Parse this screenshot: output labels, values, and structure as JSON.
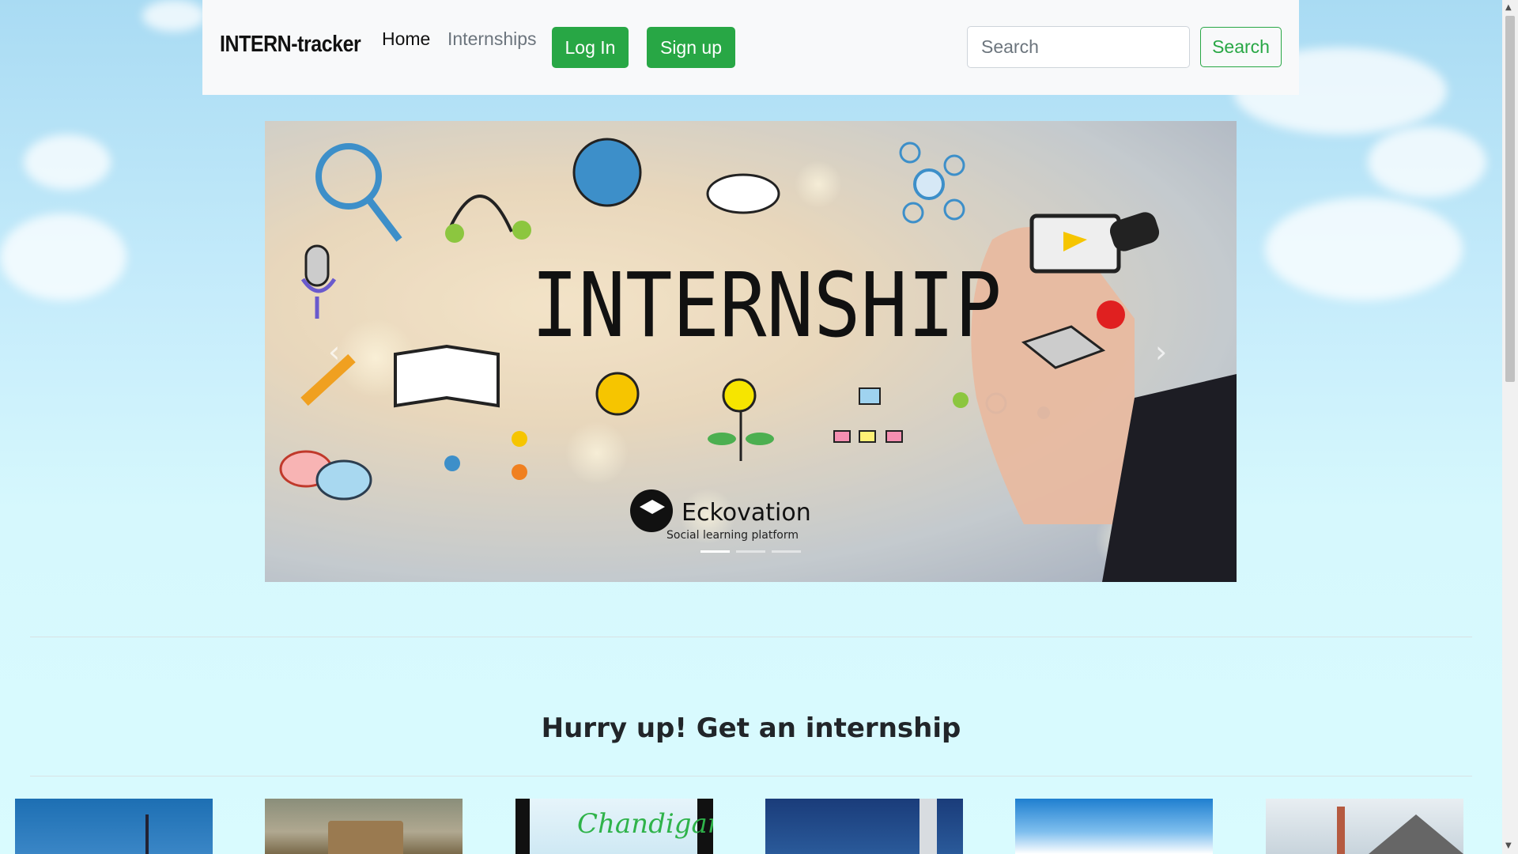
{
  "navbar": {
    "brand": "INTERN-tracker",
    "home_label": "Home",
    "internships_label": "Internships",
    "login_label": "Log In",
    "signup_label": "Sign up",
    "search_placeholder": "Search",
    "search_button_label": "Search"
  },
  "carousel": {
    "slide_title": "INTERNSHIP",
    "logo_name": "Eckovation",
    "logo_tagline": "Social learning platform",
    "indicator_count": 3,
    "active_index": 0
  },
  "main": {
    "headline": "Hurry up! Get an internship"
  },
  "cities": [
    {
      "label": ""
    },
    {
      "label": ""
    },
    {
      "label": "Chandigarh"
    },
    {
      "label": ""
    },
    {
      "label": ""
    },
    {
      "label": ""
    }
  ],
  "colors": {
    "primary_green": "#28a745",
    "navbar_bg": "#f8f9fa"
  }
}
